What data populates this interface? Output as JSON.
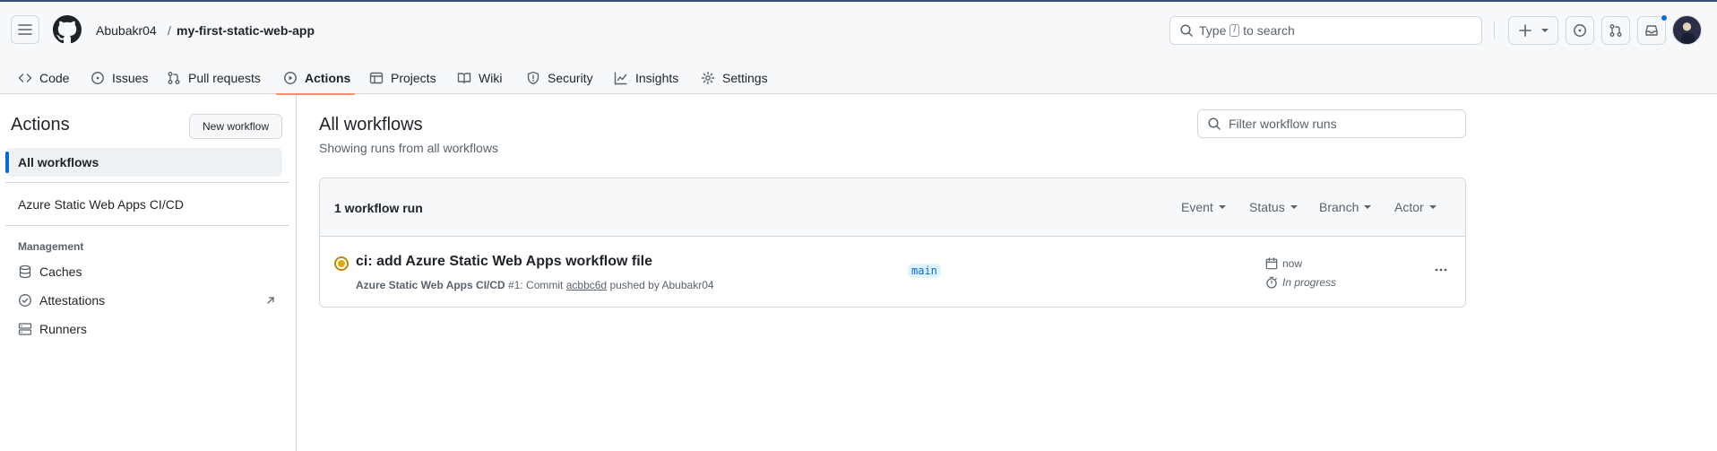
{
  "header": {
    "owner": "Abubakr04",
    "separator": "/",
    "repo": "my-first-static-web-app",
    "search_prefix": "Type",
    "search_key": "/",
    "search_suffix": "to search",
    "notification_dot_color": "#0969da"
  },
  "repo_nav": {
    "tabs": [
      {
        "label": "Code",
        "icon": "code-icon"
      },
      {
        "label": "Issues",
        "icon": "issue-opened-icon"
      },
      {
        "label": "Pull requests",
        "icon": "git-pull-request-icon"
      },
      {
        "label": "Actions",
        "icon": "play-icon",
        "active": true
      },
      {
        "label": "Projects",
        "icon": "table-icon"
      },
      {
        "label": "Wiki",
        "icon": "book-icon"
      },
      {
        "label": "Security",
        "icon": "shield-icon"
      },
      {
        "label": "Insights",
        "icon": "graph-icon"
      },
      {
        "label": "Settings",
        "icon": "gear-icon"
      }
    ],
    "active_underline_color": "#fd8c73"
  },
  "sidebar": {
    "title": "Actions",
    "new_workflow_label": "New workflow",
    "all_workflows_label": "All workflows",
    "workflows": [
      "Azure Static Web Apps CI/CD"
    ],
    "management_heading": "Management",
    "management_items": [
      {
        "label": "Caches",
        "icon": "database-icon"
      },
      {
        "label": "Attestations",
        "icon": "verified-icon"
      },
      {
        "label": "Runners",
        "icon": "server-icon"
      }
    ]
  },
  "main": {
    "title": "All workflows",
    "subtitle": "Showing runs from all workflows",
    "filter_placeholder": "Filter workflow runs",
    "run_count_label": "1 workflow run",
    "filters": [
      "Event",
      "Status",
      "Branch",
      "Actor"
    ],
    "runs": [
      {
        "title": "ci: add Azure Static Web Apps workflow file",
        "workflow": "Azure Static Web Apps CI/CD",
        "run_number": "#1",
        "commit_prefix": ": Commit",
        "commit_sha": "acbbc6d",
        "pushed_by": "pushed by Abubakr04",
        "branch": "main",
        "time": "now",
        "status": "In progress",
        "status_color": "#bf8700"
      }
    ]
  }
}
